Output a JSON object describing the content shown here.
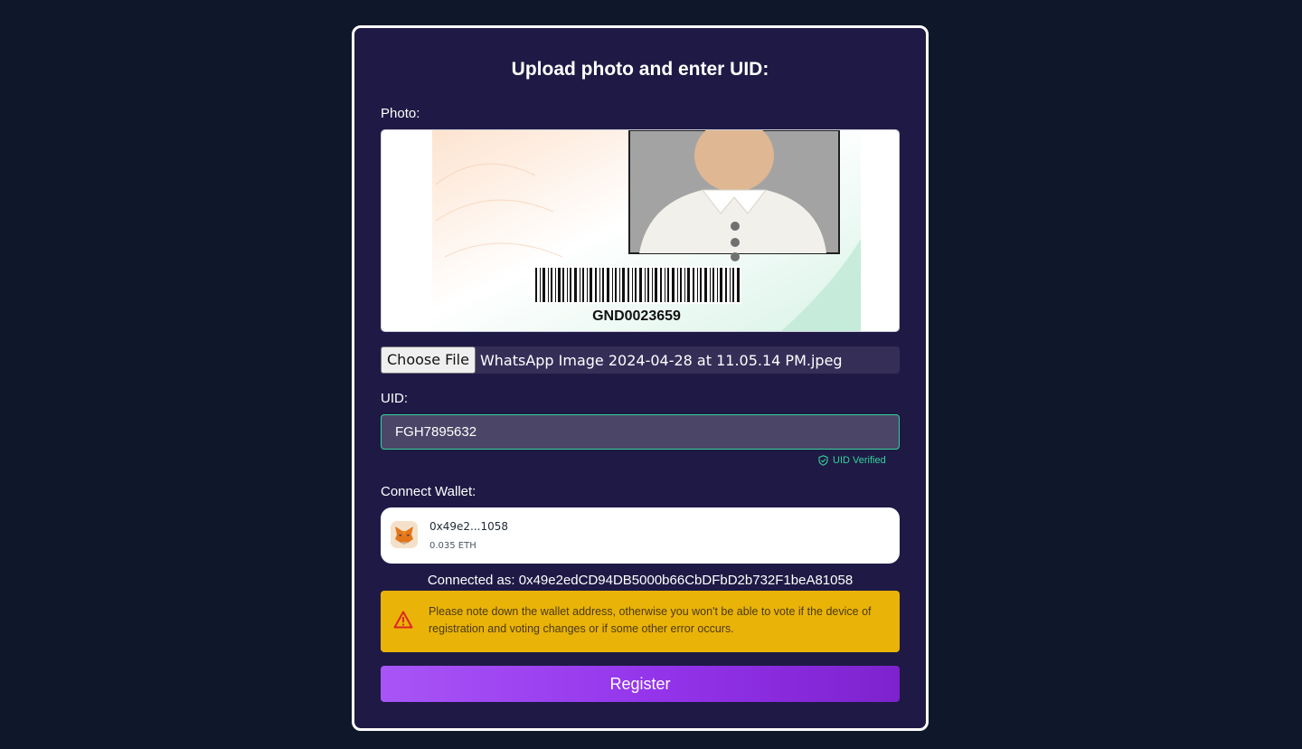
{
  "form": {
    "title": "Upload photo and enter UID:",
    "photo_label": "Photo:",
    "photo_barcode_text": "GND0023659",
    "choose_file_label": "Choose File",
    "file_name": "WhatsApp Image 2024-04-28 at 11.05.14 PM.jpeg",
    "uid_label": "UID:",
    "uid_value": "FGH7895632",
    "uid_status": "UID Verified",
    "wallet_label": "Connect Wallet:",
    "register_label": "Register"
  },
  "wallet": {
    "short_address": "0x49e2...1058",
    "balance": "0.035 ETH",
    "connected_text": "Connected as: 0x49e2edCD94DB5000b66CbDFbD2b732F1beA81058",
    "icon": "metamask-fox-icon"
  },
  "warning": {
    "icon": "warning-triangle-icon",
    "text": "Please note down the wallet address, otherwise you won't be able to vote if the device of registration and voting changes or if some other error occurs."
  },
  "colors": {
    "page_bg": "#0f172a",
    "card_bg": "#1f1a45",
    "success": "#34d399",
    "warning_bg": "#eab308",
    "button_start": "#a855f7",
    "button_end": "#7e22ce"
  }
}
